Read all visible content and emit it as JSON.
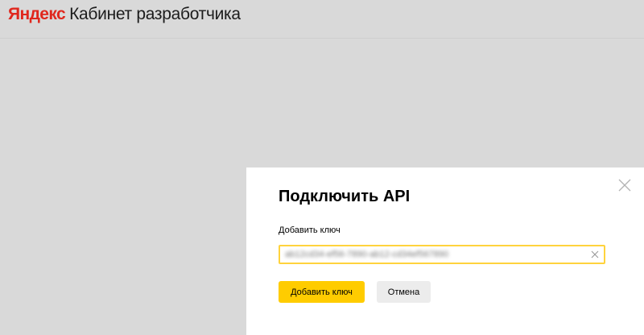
{
  "header": {
    "logo_text": "Яндекс",
    "title": "Кабинет разработчика"
  },
  "modal": {
    "title": "Подключить API",
    "field_label": "Добавить ключ",
    "input_value": "ab12cd34-ef56-7890-ab12-cd34ef567890",
    "input_state": "focused, value blurred",
    "submit_label": "Добавить ключ",
    "cancel_label": "Отмена"
  },
  "icons": {
    "close": "close-icon",
    "clear": "clear-input-icon"
  },
  "colors": {
    "logo_red": "#e0271d",
    "backdrop": "#d9d9d9",
    "primary_button": "#ffcc00",
    "input_focus_border": "#ffd33d",
    "secondary_button": "#ececec"
  }
}
